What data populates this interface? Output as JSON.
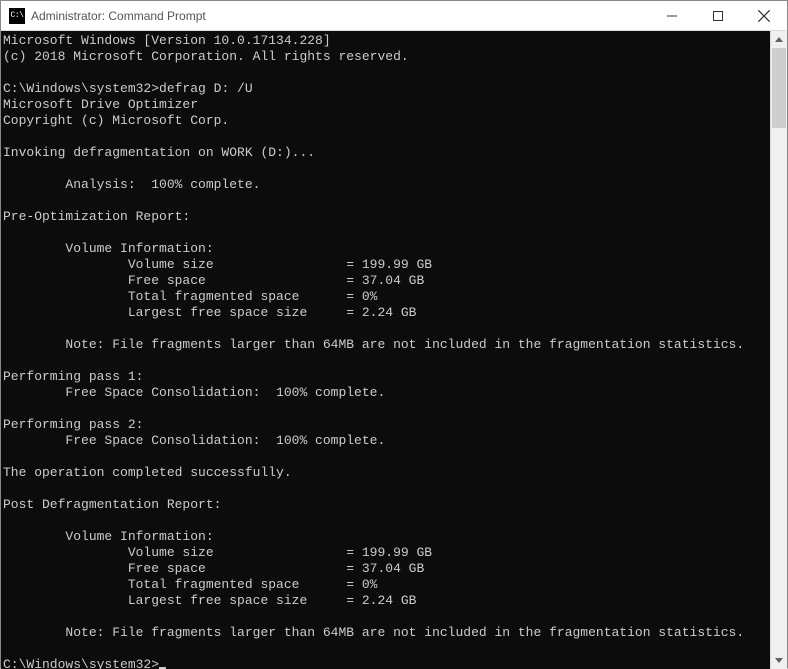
{
  "window": {
    "title": "Administrator: Command Prompt",
    "icon_label": "C:\\"
  },
  "console": {
    "banner_line1": "Microsoft Windows [Version 10.0.17134.228]",
    "banner_line2": "(c) 2018 Microsoft Corporation. All rights reserved.",
    "prompt1_prefix": "C:\\Windows\\system32>",
    "prompt1_cmd": "defrag D: /U",
    "tool_name": "Microsoft Drive Optimizer",
    "tool_copyright": "Copyright (c) Microsoft Corp.",
    "invoking": "Invoking defragmentation on WORK (D:)...",
    "analysis": "        Analysis:  100% complete.",
    "preopt_header": "Pre-Optimization Report:",
    "volinfo_header": "        Volume Information:",
    "vol_size": "                Volume size                 = 199.99 GB",
    "free_space": "                Free space                  = 37.04 GB",
    "frag_space": "                Total fragmented space      = 0%",
    "largest_free": "                Largest free space size     = 2.24 GB",
    "note": "        Note: File fragments larger than 64MB are not included in the fragmentation statistics.",
    "pass1_header": "Performing pass 1:",
    "pass1_line": "        Free Space Consolidation:  100% complete.",
    "pass2_header": "Performing pass 2:",
    "pass2_line": "        Free Space Consolidation:  100% complete.",
    "completed": "The operation completed successfully.",
    "post_header": "Post Defragmentation Report:",
    "prompt2_prefix": "C:\\Windows\\system32>"
  },
  "data_extracted": {
    "os_version": "10.0.17134.228",
    "copyright_year": 2018,
    "command": "defrag D: /U",
    "drive_label": "WORK",
    "drive_letter": "D:",
    "analysis_complete_pct": 100,
    "pre_optimization": {
      "volume_size_gb": 199.99,
      "free_space_gb": 37.04,
      "total_fragmented_space_pct": 0,
      "largest_free_space_size_gb": 2.24
    },
    "passes": [
      {
        "n": 1,
        "task": "Free Space Consolidation",
        "complete_pct": 100
      },
      {
        "n": 2,
        "task": "Free Space Consolidation",
        "complete_pct": 100
      }
    ],
    "post_defragmentation": {
      "volume_size_gb": 199.99,
      "free_space_gb": 37.04,
      "total_fragmented_space_pct": 0,
      "largest_free_space_size_gb": 2.24
    },
    "fragment_exclude_threshold_mb": 64
  }
}
